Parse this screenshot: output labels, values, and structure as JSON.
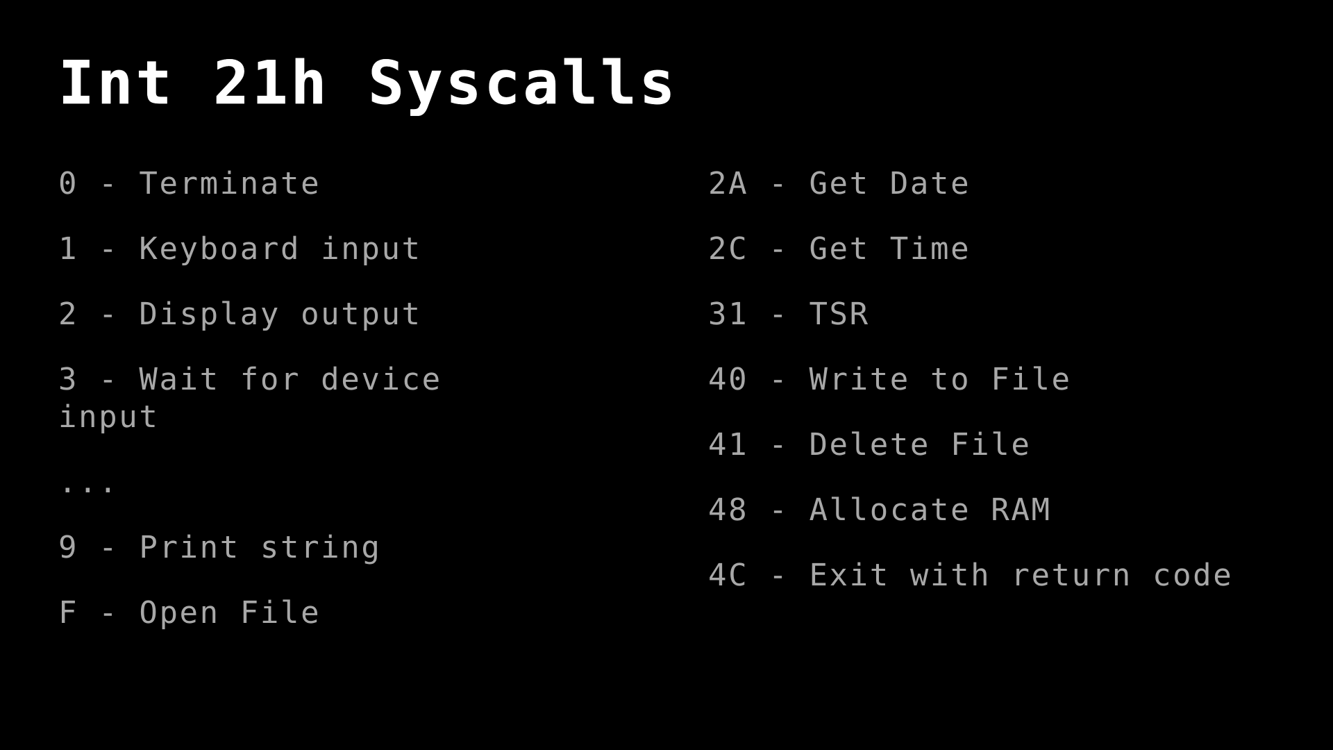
{
  "screen": {
    "background_color": "#000000",
    "title_color": "#ffffff",
    "body_color": "#a8a8a8"
  },
  "title": "Int 21h Syscalls",
  "columns": {
    "left": {
      "entries": [
        {
          "text": "0 - Terminate"
        },
        {
          "text": "1 - Keyboard input"
        },
        {
          "text": "2 - Display output"
        },
        {
          "text": "3 - Wait for device input"
        },
        {
          "text": "..."
        },
        {
          "text": "9 - Print string"
        },
        {
          "text": "F - Open File"
        }
      ]
    },
    "right": {
      "entries": [
        {
          "text": "2A - Get Date"
        },
        {
          "text": "2C - Get Time"
        },
        {
          "text": "31 - TSR"
        },
        {
          "text": "40 - Write to File"
        },
        {
          "text": "41 - Delete File"
        },
        {
          "text": "48 - Allocate RAM"
        },
        {
          "text": "4C - Exit with return code"
        }
      ]
    }
  }
}
